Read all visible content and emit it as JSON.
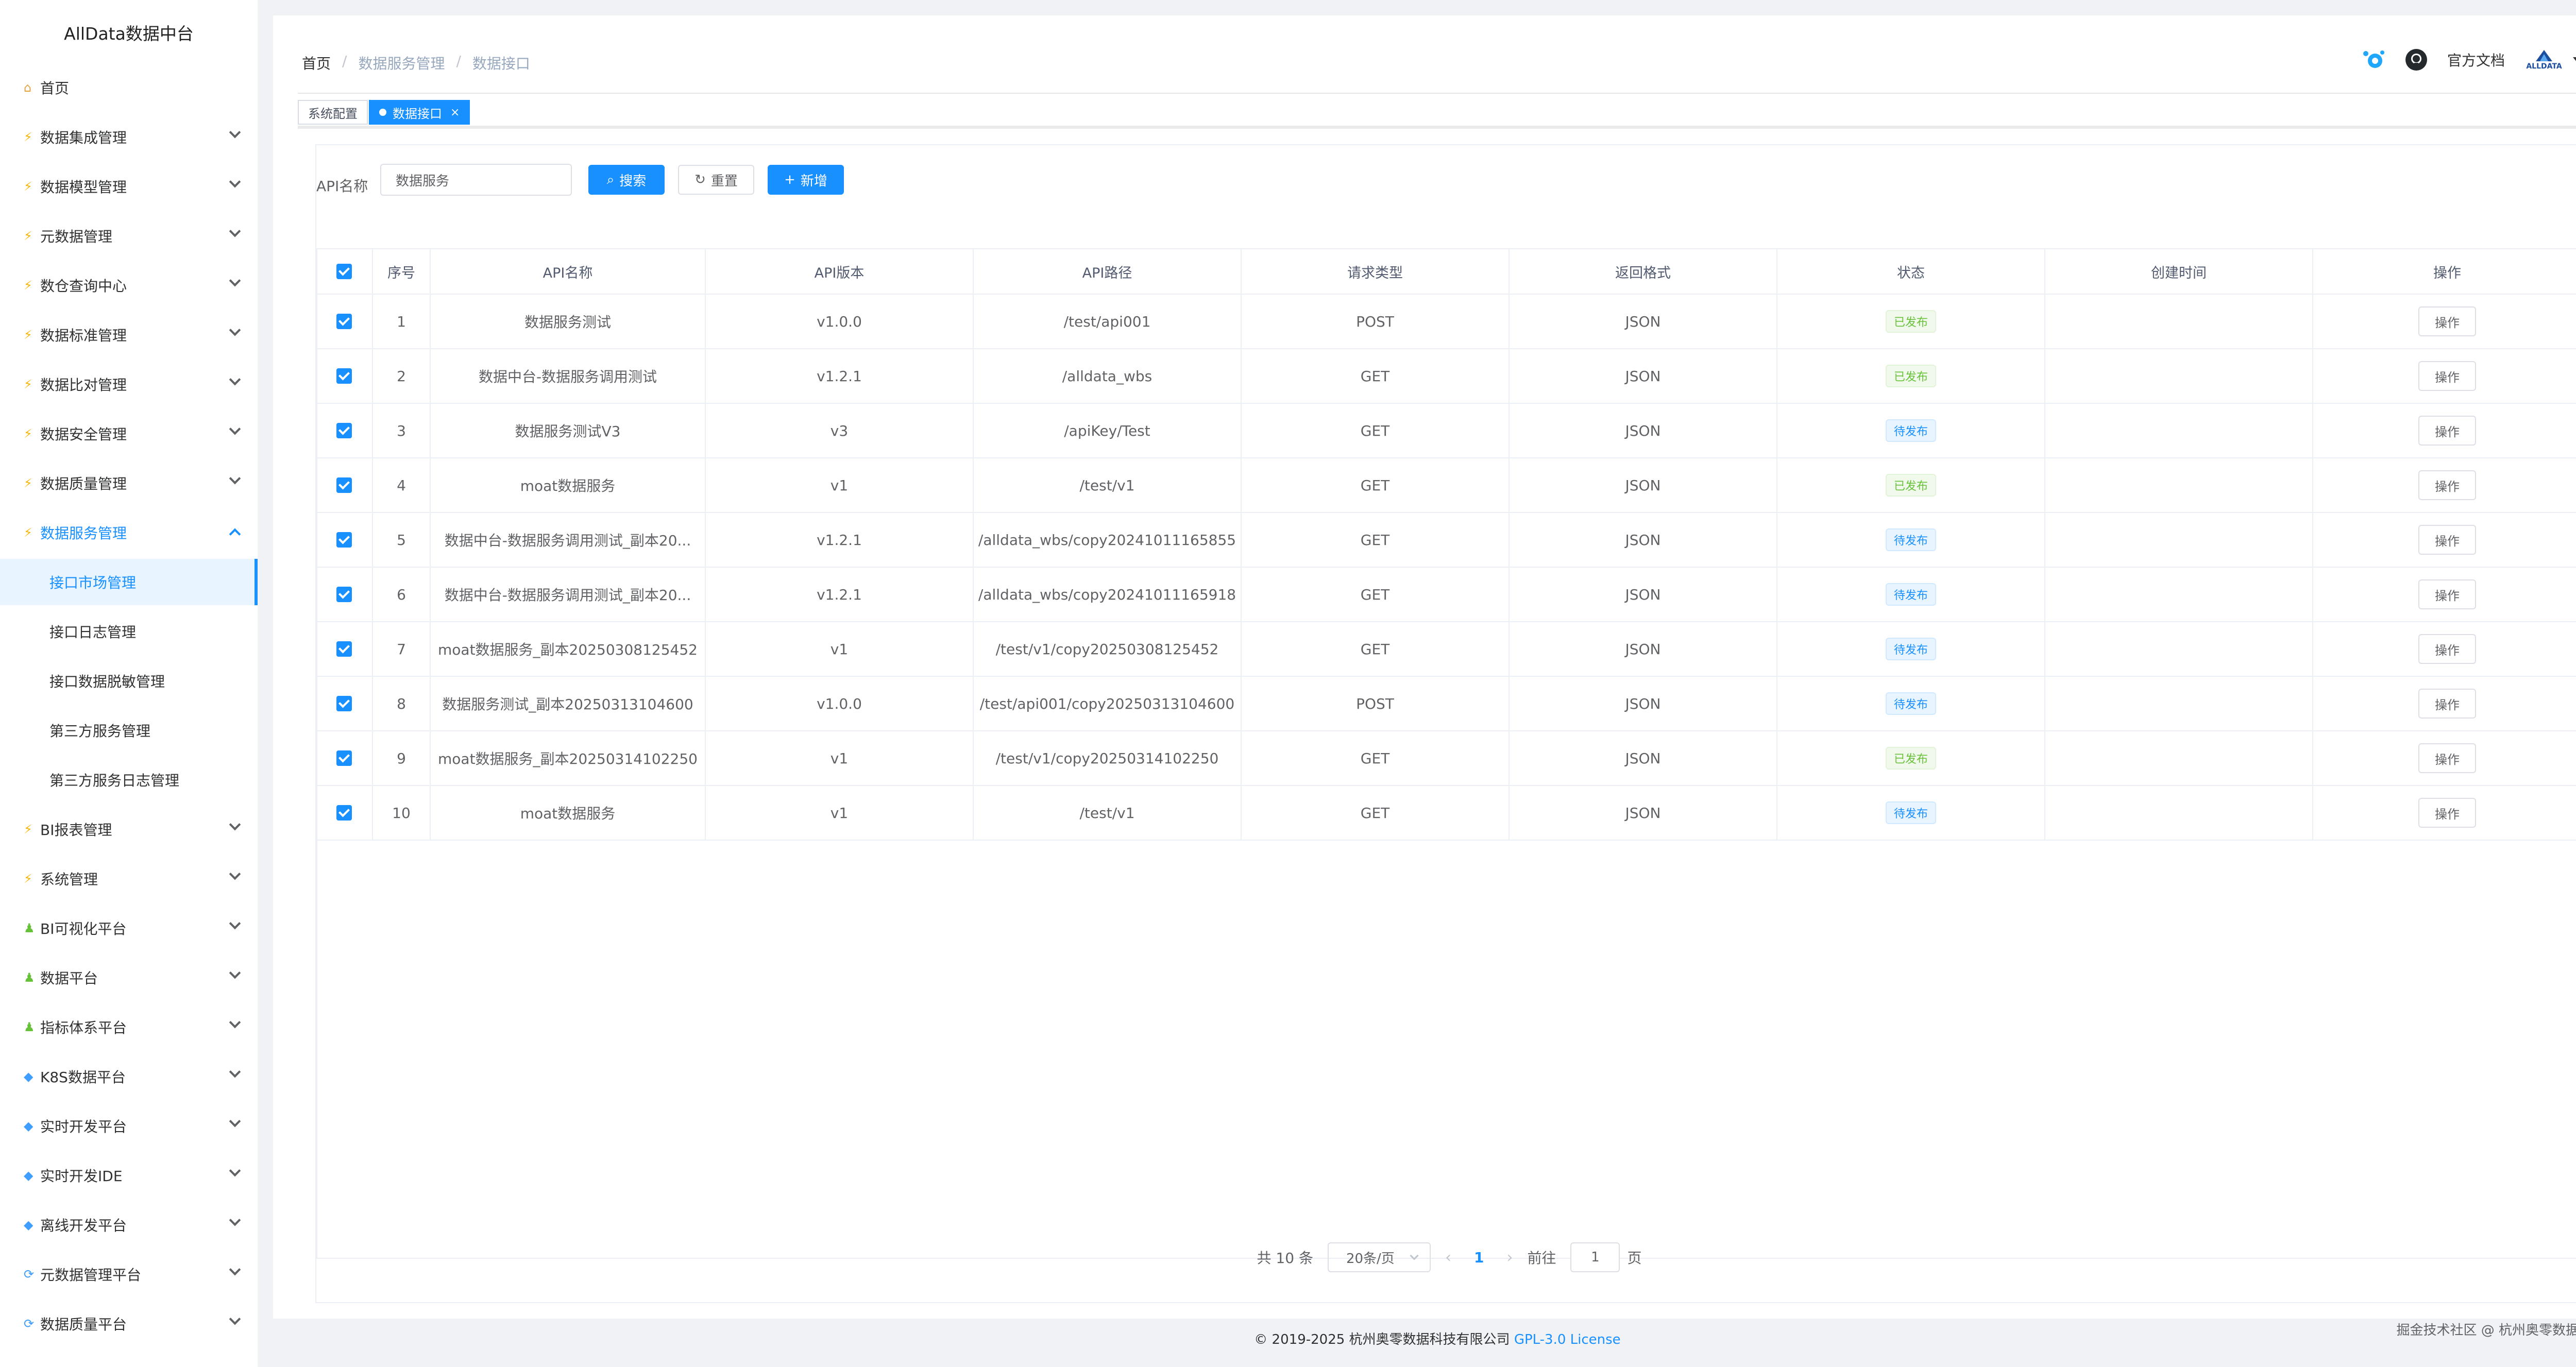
{
  "app": {
    "title": "AllData数据中台"
  },
  "sidebar": {
    "items": [
      {
        "label": "首页",
        "icon": "home-icon"
      },
      {
        "label": "数据集成管理",
        "icon": "bolt-icon"
      },
      {
        "label": "数据模型管理",
        "icon": "bolt-icon"
      },
      {
        "label": "元数据管理",
        "icon": "bolt-icon"
      },
      {
        "label": "数仓查询中心",
        "icon": "bolt-icon"
      },
      {
        "label": "数据标准管理",
        "icon": "bolt-icon"
      },
      {
        "label": "数据比对管理",
        "icon": "bolt-icon"
      },
      {
        "label": "数据安全管理",
        "icon": "bolt-icon"
      },
      {
        "label": "数据质量管理",
        "icon": "bolt-icon"
      },
      {
        "label": "数据服务管理",
        "icon": "bolt-icon"
      },
      {
        "label": "BI报表管理",
        "icon": "bolt-icon"
      },
      {
        "label": "系统管理",
        "icon": "bolt-icon"
      },
      {
        "label": "BI可视化平台",
        "icon": "person-icon"
      },
      {
        "label": "数据平台",
        "icon": "person-icon"
      },
      {
        "label": "指标体系平台",
        "icon": "person-icon"
      },
      {
        "label": "K8S数据平台",
        "icon": "diamond-icon"
      },
      {
        "label": "实时开发平台",
        "icon": "diamond-icon"
      },
      {
        "label": "实时开发IDE",
        "icon": "diamond-icon"
      },
      {
        "label": "离线开发平台",
        "icon": "diamond-icon"
      },
      {
        "label": "元数据管理平台",
        "icon": "cycle-icon"
      },
      {
        "label": "数据质量平台",
        "icon": "cycle-icon"
      }
    ],
    "subitems": [
      {
        "label": "接口市场管理"
      },
      {
        "label": "接口日志管理"
      },
      {
        "label": "接口数据脱敏管理"
      },
      {
        "label": "第三方服务管理"
      },
      {
        "label": "第三方服务日志管理"
      }
    ]
  },
  "breadcrumb": {
    "items": [
      "首页",
      "数据服务管理",
      "数据接口"
    ],
    "sep": "/"
  },
  "header": {
    "docs_label": "官方文档",
    "brand_label": "ALLDATA"
  },
  "tabs": [
    {
      "label": "系统配置"
    },
    {
      "label": "数据接口",
      "close": "×"
    }
  ],
  "search": {
    "label": "API名称",
    "value": "数据服务",
    "search_btn": "搜索",
    "reset_btn": "重置",
    "add_btn": "新增",
    "search_icon": "⌕",
    "reset_icon": "↻",
    "add_icon": "+"
  },
  "table": {
    "columns": [
      "",
      "序号",
      "API名称",
      "API版本",
      "API路径",
      "请求类型",
      "返回格式",
      "状态",
      "创建时间",
      "操作"
    ],
    "rows": [
      {
        "idx": "1",
        "name": "数据服务测试",
        "version": "v1.0.0",
        "path": "/test/api001",
        "method": "POST",
        "format": "JSON",
        "status": "已发布",
        "status_type": "green",
        "created": "",
        "op": "操作"
      },
      {
        "idx": "2",
        "name": "数据中台-数据服务调用测试",
        "version": "v1.2.1",
        "path": "/alldata_wbs",
        "method": "GET",
        "format": "JSON",
        "status": "已发布",
        "status_type": "green",
        "created": "",
        "op": "操作"
      },
      {
        "idx": "3",
        "name": "数据服务测试V3",
        "version": "v3",
        "path": "/apiKey/Test",
        "method": "GET",
        "format": "JSON",
        "status": "待发布",
        "status_type": "blue",
        "created": "",
        "op": "操作"
      },
      {
        "idx": "4",
        "name": "moat数据服务",
        "version": "v1",
        "path": "/test/v1",
        "method": "GET",
        "format": "JSON",
        "status": "已发布",
        "status_type": "green",
        "created": "",
        "op": "操作"
      },
      {
        "idx": "5",
        "name": "数据中台-数据服务调用测试_副本20...",
        "version": "v1.2.1",
        "path": "/alldata_wbs/copy20241011165855",
        "method": "GET",
        "format": "JSON",
        "status": "待发布",
        "status_type": "blue",
        "created": "",
        "op": "操作"
      },
      {
        "idx": "6",
        "name": "数据中台-数据服务调用测试_副本20...",
        "version": "v1.2.1",
        "path": "/alldata_wbs/copy20241011165918",
        "method": "GET",
        "format": "JSON",
        "status": "待发布",
        "status_type": "blue",
        "created": "",
        "op": "操作"
      },
      {
        "idx": "7",
        "name": "moat数据服务_副本20250308125452",
        "version": "v1",
        "path": "/test/v1/copy20250308125452",
        "method": "GET",
        "format": "JSON",
        "status": "待发布",
        "status_type": "blue",
        "created": "",
        "op": "操作"
      },
      {
        "idx": "8",
        "name": "数据服务测试_副本20250313104600",
        "version": "v1.0.0",
        "path": "/test/api001/copy20250313104600",
        "method": "POST",
        "format": "JSON",
        "status": "待发布",
        "status_type": "blue",
        "created": "",
        "op": "操作"
      },
      {
        "idx": "9",
        "name": "moat数据服务_副本20250314102250",
        "version": "v1",
        "path": "/test/v1/copy20250314102250",
        "method": "GET",
        "format": "JSON",
        "status": "已发布",
        "status_type": "green",
        "created": "",
        "op": "操作"
      },
      {
        "idx": "10",
        "name": "moat数据服务",
        "version": "v1",
        "path": "/test/v1",
        "method": "GET",
        "format": "JSON",
        "status": "待发布",
        "status_type": "blue",
        "created": "",
        "op": "操作"
      }
    ]
  },
  "pagination": {
    "total": "共 10 条",
    "page_size": "20条/页",
    "current": "1",
    "prev": "‹",
    "next": "›",
    "goto_label": "前往",
    "goto_value": "1",
    "page_suffix": "页"
  },
  "footer": {
    "copyright": "© 2019-2025 杭州奥零数据科技有限公司",
    "license": "GPL-3.0 License"
  },
  "watermark": {
    "text": "掘金技术社区 @ 杭州奥零数据科技"
  },
  "colors": {
    "primary": "#1890ff",
    "success": "#67c23a",
    "sidebar_bg": "#ffffff",
    "page_bg": "#f0f2f5"
  }
}
